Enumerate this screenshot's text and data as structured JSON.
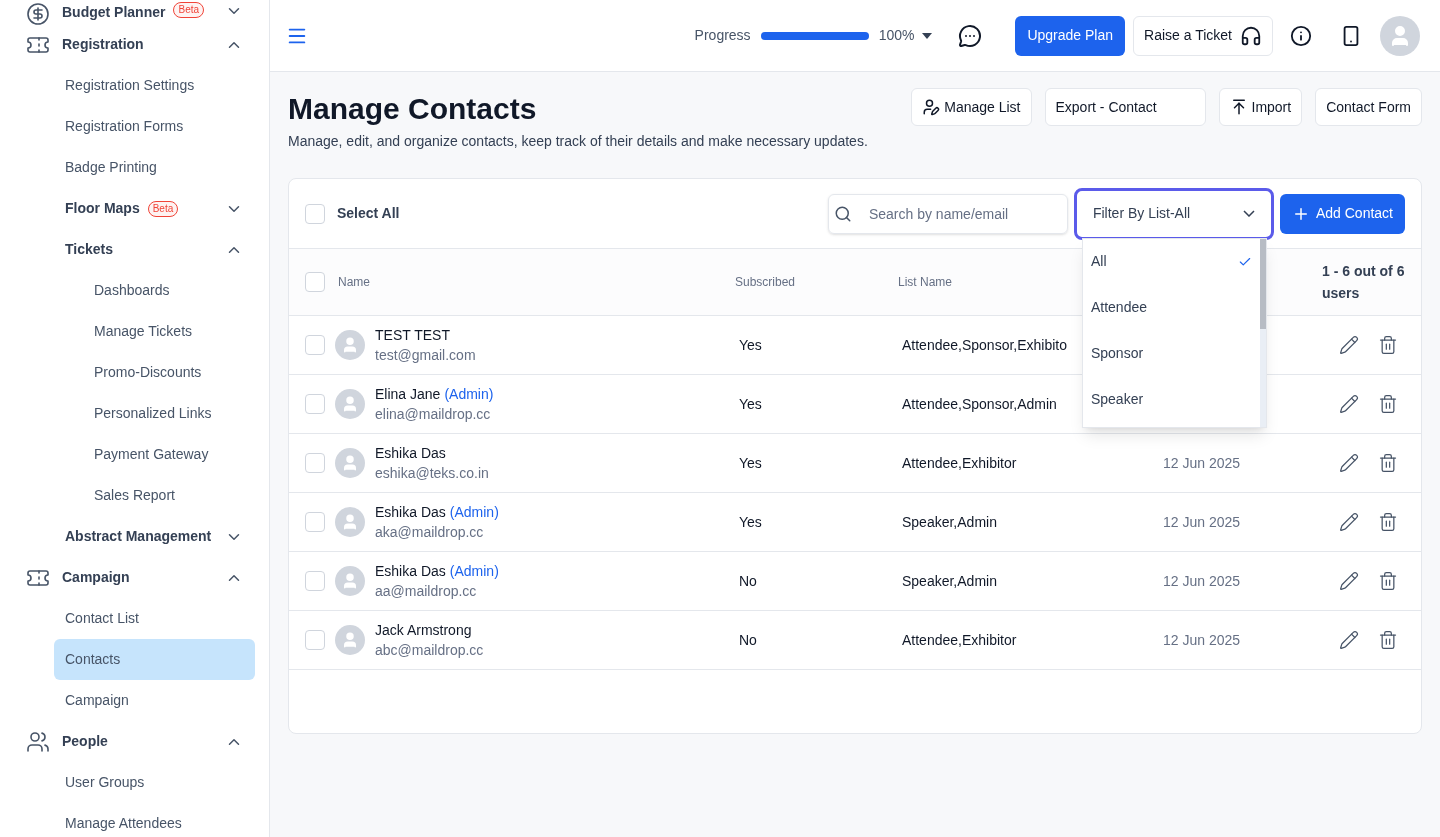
{
  "sidebar": {
    "items": [
      {
        "label": "Budget Planner",
        "badge": "Beta",
        "expanded": false
      },
      {
        "label": "Registration",
        "expanded": true,
        "children": [
          {
            "label": "Registration Settings",
            "selected": false
          },
          {
            "label": "Registration Forms",
            "selected": false
          },
          {
            "label": "Badge Printing",
            "selected": false
          },
          {
            "label": "Floor Maps",
            "badge": "Beta",
            "expanded": false
          },
          {
            "label": "Tickets",
            "expanded": true,
            "children": [
              {
                "label": "Dashboards",
                "selected": false
              },
              {
                "label": "Manage Tickets",
                "selected": false
              },
              {
                "label": "Promo-Discounts",
                "selected": false
              },
              {
                "label": "Personalized Links",
                "selected": false
              },
              {
                "label": "Payment Gateway",
                "selected": false
              },
              {
                "label": "Sales Report",
                "selected": false
              }
            ]
          },
          {
            "label": "Abstract Management",
            "expanded": false
          }
        ]
      },
      {
        "label": "Campaign",
        "expanded": true,
        "children": [
          {
            "label": "Contact List",
            "selected": false
          },
          {
            "label": "Contacts",
            "selected": true
          },
          {
            "label": "Campaign",
            "selected": false
          }
        ]
      },
      {
        "label": "People",
        "expanded": true,
        "children": [
          {
            "label": "User Groups",
            "selected": false
          },
          {
            "label": "Manage Attendees",
            "selected": false
          }
        ]
      }
    ]
  },
  "header": {
    "progress": {
      "label": "Progress",
      "level": 1,
      "reading": "100%"
    },
    "upgrade_button": "Upgrade Plan",
    "ticket_button": "Raise a Ticket"
  },
  "page": {
    "title": "Manage Contacts",
    "subtitle": "Manage, edit, and organize contacts, keep track of their details and make necessary updates.",
    "actions": [
      "Manage List",
      "Export - Contact",
      "Import",
      "Contact Form"
    ]
  },
  "toolbar": {
    "select_all": {
      "label": "Select All",
      "checked": false
    },
    "search": {
      "placeholder": "Search by name/email"
    },
    "filter": {
      "value": "Filter By List-All",
      "expanded": true,
      "options": [
        {
          "label": "All",
          "selected": true
        },
        {
          "label": "Attendee",
          "selected": false
        },
        {
          "label": "Sponsor",
          "selected": false
        },
        {
          "label": "Speaker",
          "selected": false
        }
      ]
    },
    "add_button": "Add Contact"
  },
  "table": {
    "columns": [
      "Name",
      "Subscribed",
      "List Name"
    ],
    "count": "1 - 6 out of 6 users",
    "header_checked": false,
    "rows": [
      {
        "name": "TEST TEST",
        "email": "test@gmail.com",
        "subscribed": "Yes",
        "lists": "Attendee,Sponsor,Exhibito",
        "checked": false
      },
      {
        "name": "Elina Jane",
        "tag": "(Admin)",
        "email": "elina@maildrop.cc",
        "subscribed": "Yes",
        "lists": "Attendee,Sponsor,Admin",
        "checked": false
      },
      {
        "name": "Eshika Das",
        "email": "eshika@teks.co.in",
        "subscribed": "Yes",
        "lists": "Attendee,Exhibitor",
        "date": "12 Jun 2025",
        "checked": false
      },
      {
        "name": "Eshika Das",
        "tag": "(Admin)",
        "email": "aka@maildrop.cc",
        "subscribed": "Yes",
        "lists": "Speaker,Admin",
        "date": "12 Jun 2025",
        "checked": false
      },
      {
        "name": "Eshika Das",
        "tag": "(Admin)",
        "email": "aa@maildrop.cc",
        "subscribed": "No",
        "lists": "Speaker,Admin",
        "date": "12 Jun 2025",
        "checked": false
      },
      {
        "name": "Jack Armstrong",
        "email": "abc@maildrop.cc",
        "subscribed": "No",
        "lists": "Attendee,Exhibitor",
        "date": "12 Jun 2025",
        "checked": false
      }
    ]
  }
}
